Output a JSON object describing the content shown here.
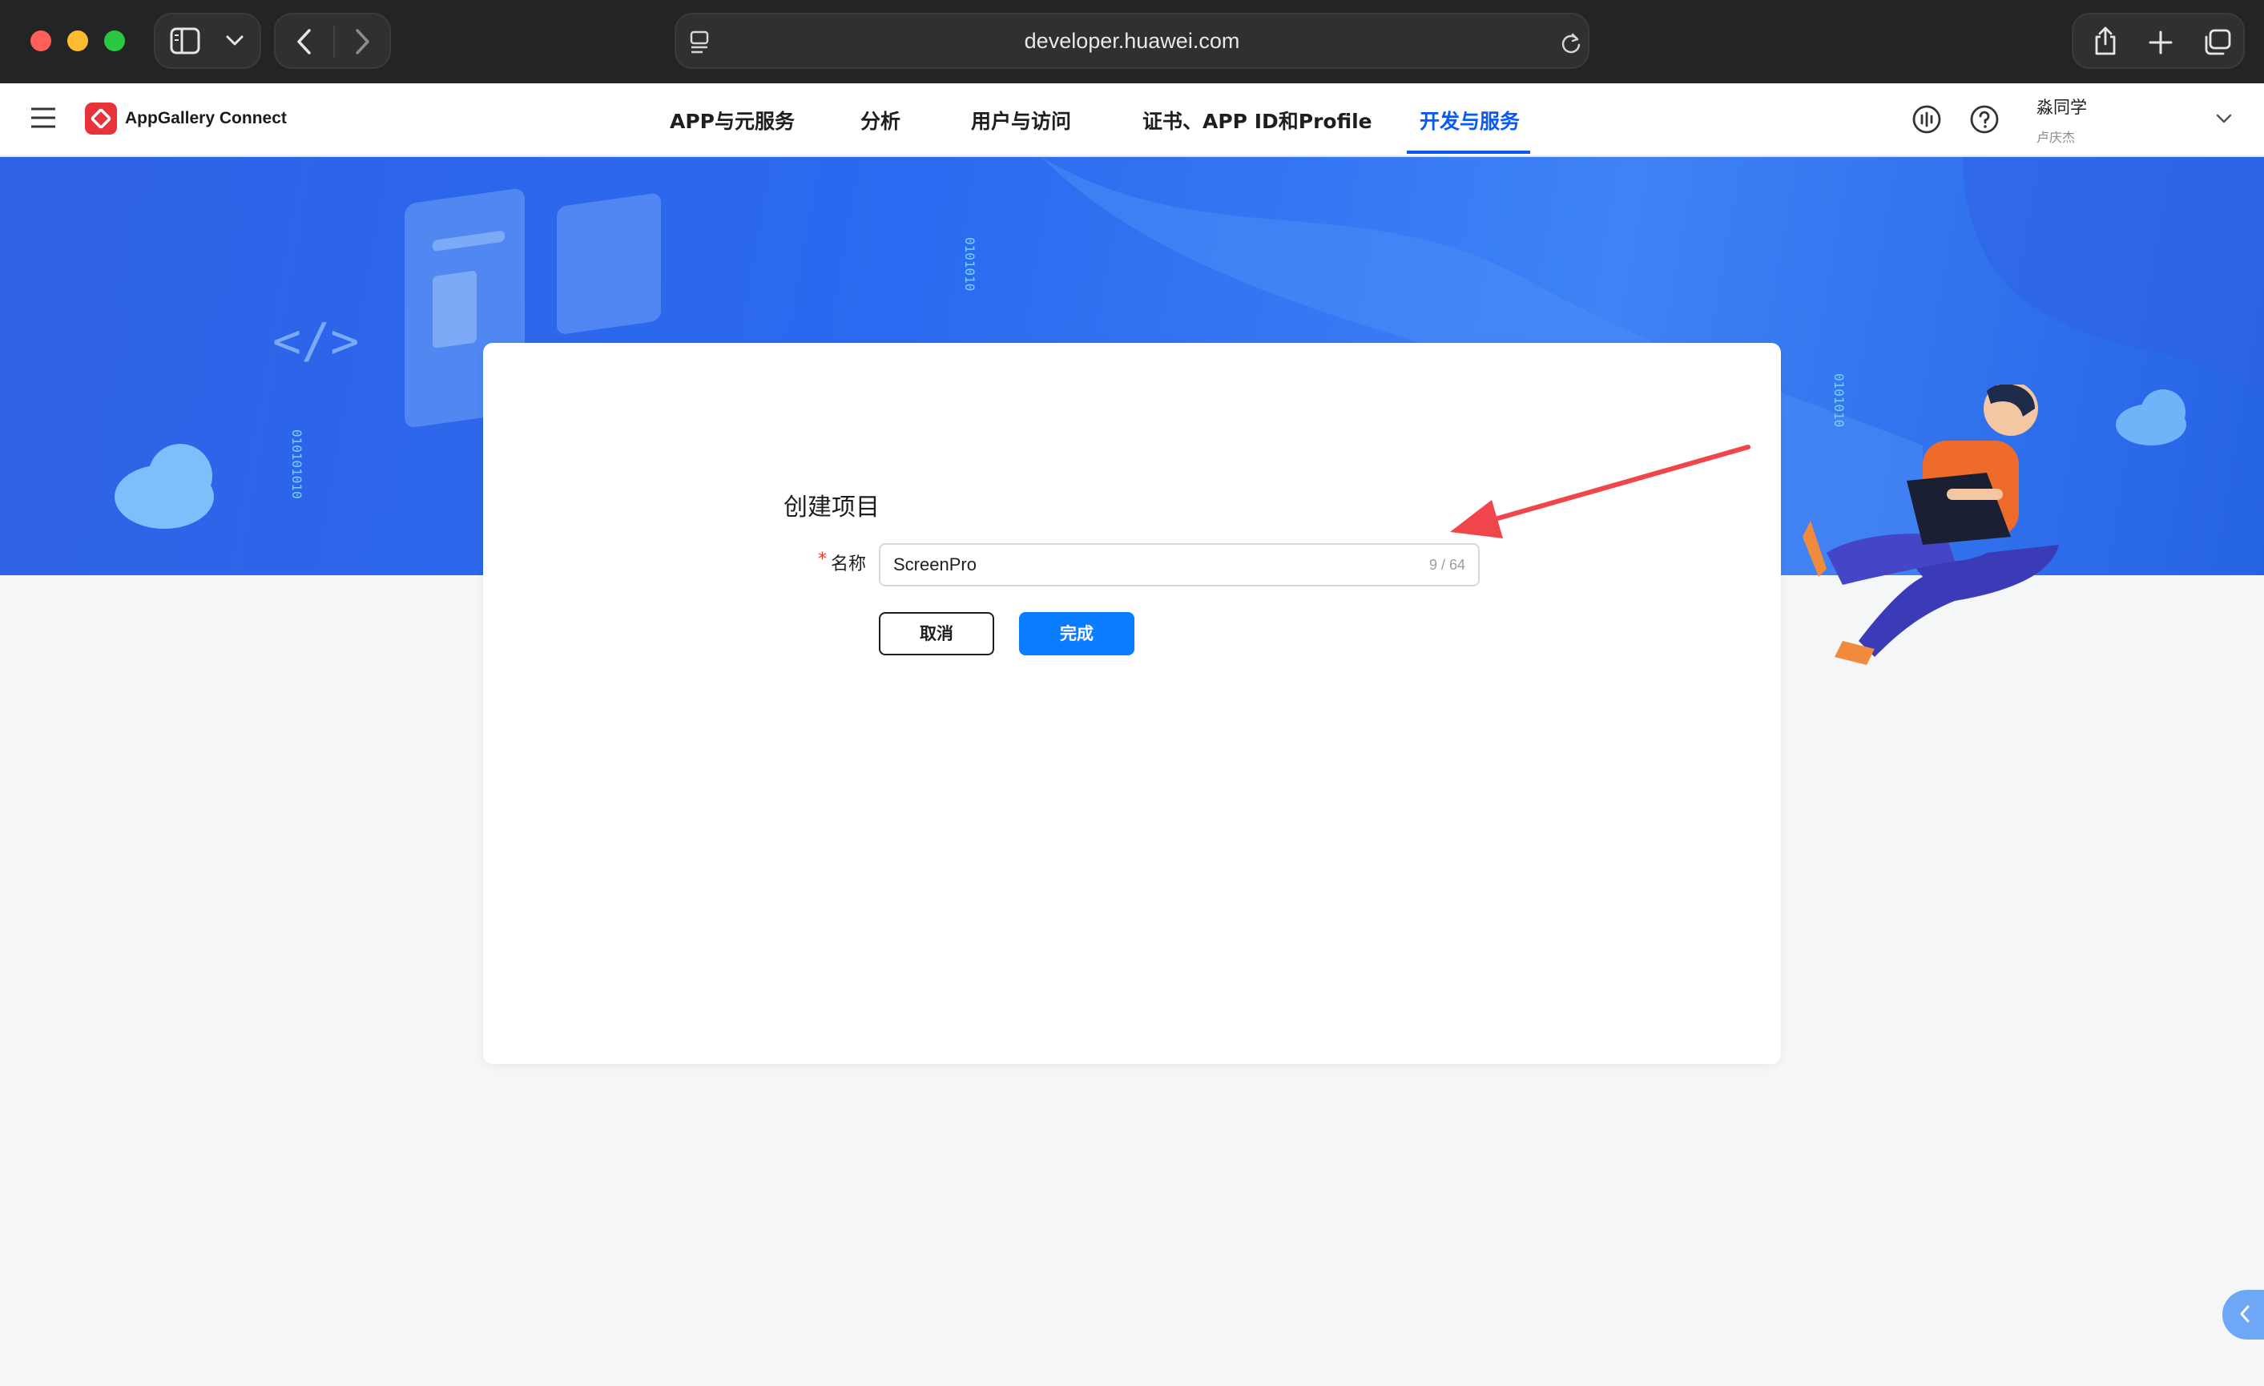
{
  "browser": {
    "url": "developer.huawei.com"
  },
  "header": {
    "brand": "AppGallery Connect",
    "nav_tabs": [
      {
        "label": "APP与元服务",
        "active": false
      },
      {
        "label": "分析",
        "active": false
      },
      {
        "label": "用户与访问",
        "active": false
      },
      {
        "label": "证书、APP ID和Profile",
        "active": false
      },
      {
        "label": "开发与服务",
        "active": true
      }
    ],
    "user": {
      "name": "淼同学",
      "sub": "卢庆杰"
    }
  },
  "form": {
    "title": "创建项目",
    "required_mark": "*",
    "name_label": "名称",
    "name_value": "ScreenPro",
    "name_counter": "9 / 64",
    "cancel_label": "取消",
    "done_label": "完成"
  },
  "colors": {
    "accent": "#0a59f7",
    "primary_button": "#0a7cff",
    "annotation_arrow": "#f0454b",
    "banner_blue": "#2f62e6"
  },
  "icons": [
    "sidebar-icon",
    "chevron-down-icon",
    "back-icon",
    "forward-icon",
    "page-icon",
    "reload-icon",
    "share-icon",
    "plus-icon",
    "tabs-icon",
    "menu-icon",
    "huawei-logo-icon",
    "feedback-icon",
    "help-icon",
    "user-menu-chevron-icon",
    "collapse-icon"
  ]
}
